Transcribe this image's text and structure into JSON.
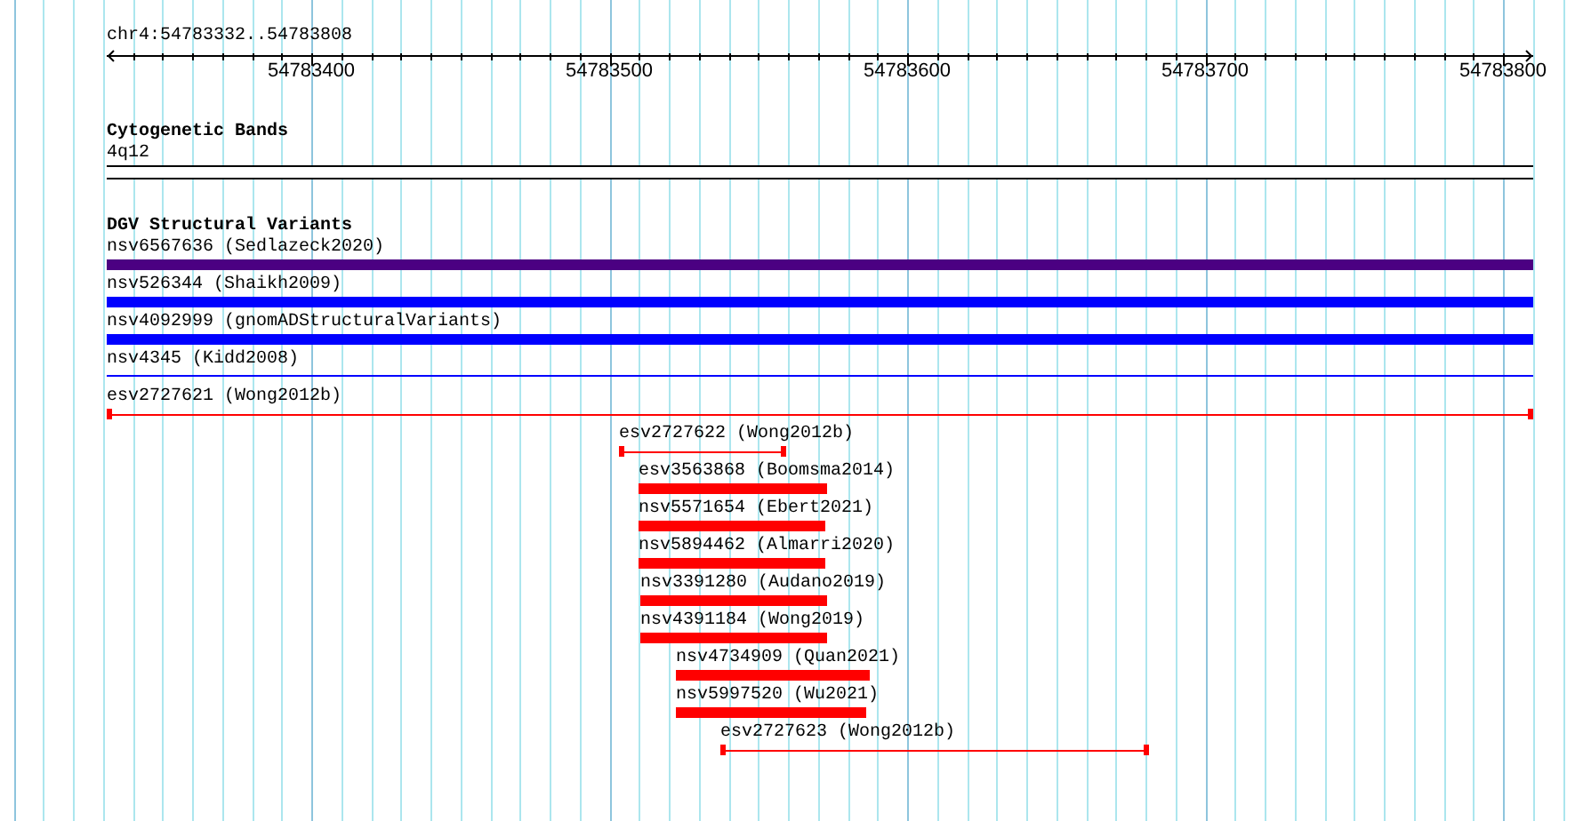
{
  "locus": "chr4:54783332..54783808",
  "ruler": {
    "ticks": [
      "54783400",
      "54783500",
      "54783600",
      "54783700",
      "54783800"
    ]
  },
  "cytogenetic_bands": {
    "title": "Cytogenetic Bands",
    "band": "4q12"
  },
  "dgv_structural_variants": {
    "title": "DGV Structural Variants",
    "features": [
      {
        "label": "nsv6567636 (Sedlazeck2020)",
        "kind": "bar",
        "color": "#4b0082"
      },
      {
        "label": "nsv526344 (Shaikh2009)",
        "kind": "bar",
        "color": "#0000ff"
      },
      {
        "label": "nsv4092999 (gnomADStructuralVariants)",
        "kind": "bar",
        "color": "#0000ff"
      },
      {
        "label": "nsv4345 (Kidd2008)",
        "kind": "line",
        "color": "#0000ff"
      },
      {
        "label": "esv2727621 (Wong2012b)",
        "kind": "capped",
        "color": "#ff0000"
      },
      {
        "label": "esv2727622 (Wong2012b)",
        "kind": "capped",
        "color": "#ff0000"
      },
      {
        "label": "esv3563868 (Boomsma2014)",
        "kind": "bar",
        "color": "#ff0000"
      },
      {
        "label": "nsv5571654 (Ebert2021)",
        "kind": "bar",
        "color": "#ff0000"
      },
      {
        "label": "nsv5894462 (Almarri2020)",
        "kind": "bar",
        "color": "#ff0000"
      },
      {
        "label": "nsv3391280 (Audano2019)",
        "kind": "bar",
        "color": "#ff0000"
      },
      {
        "label": "nsv4391184 (Wong2019)",
        "kind": "bar",
        "color": "#ff0000"
      },
      {
        "label": "nsv4734909 (Quan2021)",
        "kind": "bar",
        "color": "#ff0000"
      },
      {
        "label": "nsv5997520 (Wu2021)",
        "kind": "bar",
        "color": "#ff0000"
      },
      {
        "label": "esv2727623 (Wong2012b)",
        "kind": "capped",
        "color": "#ff0000"
      }
    ]
  }
}
